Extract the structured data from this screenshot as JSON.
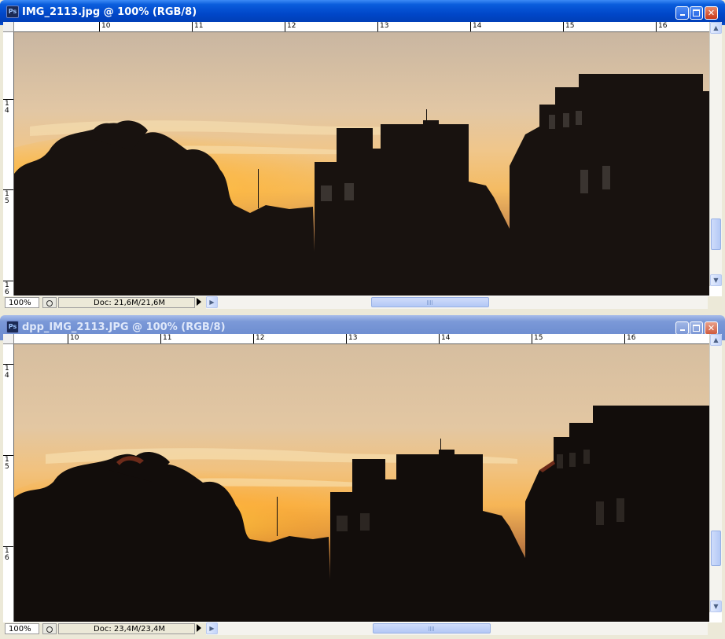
{
  "app": {
    "icon_label": "Ps"
  },
  "windows": [
    {
      "title": "IMG_2113.jpg @ 100% (RGB/8)",
      "active": true,
      "hruler_labels": [
        "10",
        "11",
        "12",
        "13",
        "14",
        "15",
        "16"
      ],
      "vruler_labels": [
        "1 4",
        "1 5",
        "1 6"
      ],
      "status": {
        "zoom": "100%",
        "doc": "Doc: 21,6M/21,6M"
      }
    },
    {
      "title": "dpp_IMG_2113.JPG @ 100% (RGB/8)",
      "active": false,
      "hruler_labels": [
        "10",
        "11",
        "12",
        "13",
        "14",
        "15",
        "16"
      ],
      "vruler_labels": [
        "1 4",
        "1 5",
        "1 6"
      ],
      "status": {
        "zoom": "100%",
        "doc": "Doc: 23,4M/23,4M"
      }
    }
  ],
  "colors": {
    "active_title": "#0a5ddc",
    "inactive_title": "#7b99d8",
    "sky_top": "#d9c0a2",
    "sky_glow": "#ffb630",
    "silhouette": "#141010"
  },
  "icons": [
    "photoshop-doc-icon",
    "minimize-icon",
    "maximize-icon",
    "close-icon",
    "scroll-up-icon",
    "scroll-down-icon",
    "scroll-left-icon",
    "scroll-right-icon",
    "navigator-icon",
    "status-menu-arrow-icon"
  ]
}
